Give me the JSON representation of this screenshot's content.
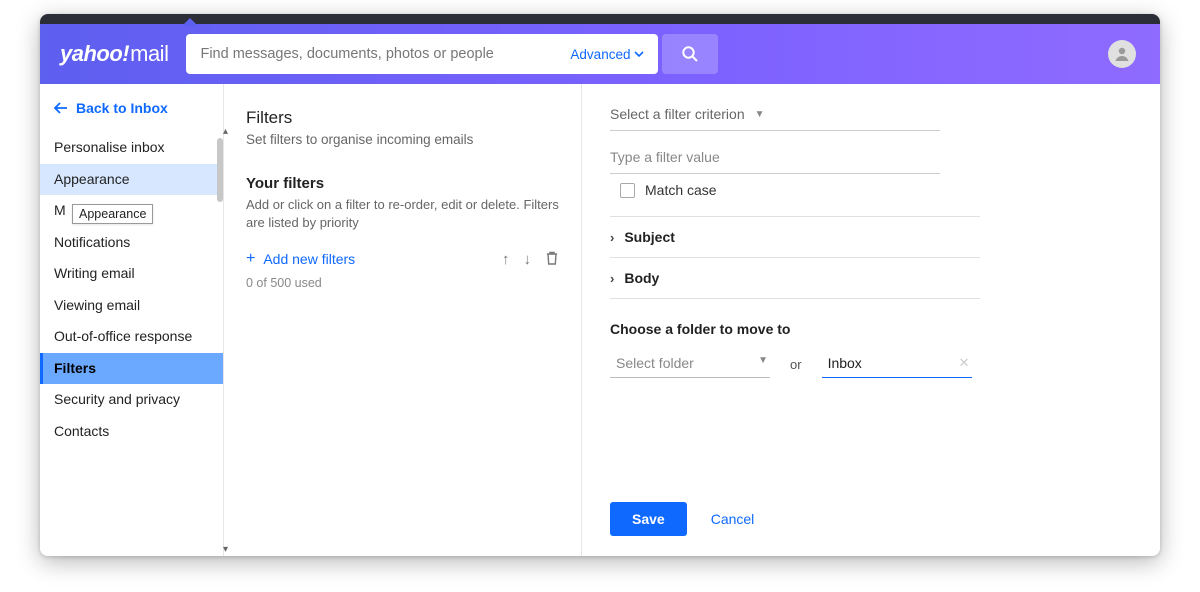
{
  "header": {
    "logo_a": "yahoo!",
    "logo_b": "mail",
    "search_placeholder": "Find messages, documents, photos or people",
    "advanced": "Advanced"
  },
  "sidebar": {
    "back": "Back to Inbox",
    "items": [
      "Personalise inbox",
      "Appearance",
      "M",
      "Notifications",
      "Writing email",
      "Viewing email",
      "Out-of-office response",
      "Filters",
      "Security and privacy",
      "Contacts"
    ],
    "tooltip": "Appearance"
  },
  "mid": {
    "title": "Filters",
    "sub": "Set filters to organise incoming emails",
    "your": "Your filters",
    "yoursub": "Add or click on a filter to re-order, edit or delete. Filters are listed by priority",
    "add": "Add new filters",
    "used": "0 of 500 used"
  },
  "right": {
    "criterion": "Select a filter criterion",
    "value_ph": "Type a filter value",
    "matchcase": "Match case",
    "subject": "Subject",
    "body": "Body",
    "choose": "Choose a folder to move to",
    "select_folder": "Select folder",
    "or": "or",
    "inbox": "Inbox",
    "save": "Save",
    "cancel": "Cancel"
  }
}
